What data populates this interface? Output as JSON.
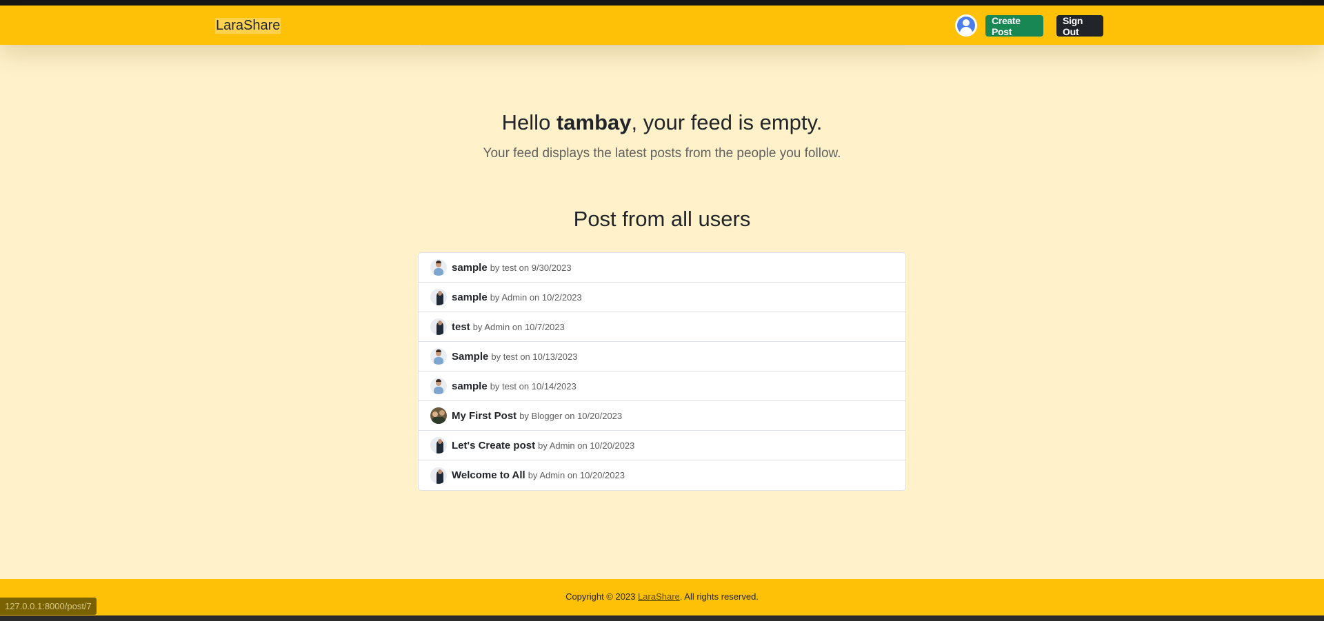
{
  "navbar": {
    "brand": "LaraShare",
    "avatar_icon": "user-circle-icon",
    "create_label": "Create Post",
    "signout_label": "Sign Out"
  },
  "hero": {
    "greeting": "Hello ",
    "username": "tambay",
    "message": ", your feed is empty.",
    "subtitle": "Your feed displays the latest posts from the people you follow."
  },
  "section": {
    "title": "Post from all users"
  },
  "posts": [
    {
      "title": "sample",
      "author": "test",
      "date": "9/30/2023"
    },
    {
      "title": "sample",
      "author": "Admin",
      "date": "10/2/2023"
    },
    {
      "title": "test",
      "author": "Admin",
      "date": "10/7/2023"
    },
    {
      "title": "Sample",
      "author": "test",
      "date": "10/13/2023"
    },
    {
      "title": "sample",
      "author": "test",
      "date": "10/14/2023"
    },
    {
      "title": "My First Post",
      "author": "Blogger",
      "date": "10/20/2023"
    },
    {
      "title": "Let's Create post",
      "author": "Admin",
      "date": "10/20/2023"
    },
    {
      "title": "Welcome to All",
      "author": "Admin",
      "date": "10/20/2023"
    }
  ],
  "meta_words": {
    "by": "by",
    "on": "on"
  },
  "footer": {
    "prefix": "Copyright © 2023 ",
    "link": "LaraShare",
    "suffix": ". All rights reserved."
  },
  "status_bar": {
    "url": "127.0.0.1:8000/post/7"
  },
  "colors": {
    "accent": "#ffc107",
    "background": "#fff2cb",
    "create_button": "#198754",
    "signout_button": "#212529"
  }
}
